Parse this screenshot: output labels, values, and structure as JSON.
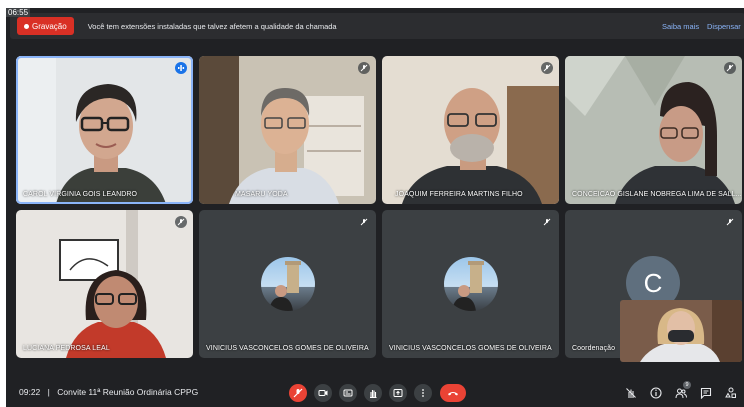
{
  "clock": "06:55",
  "banner": {
    "recording_label": "Gravação",
    "message": "Você tem extensões instaladas que talvez afetem a qualidade da chamada",
    "learn_more": "Saiba mais",
    "dismiss": "Dispensar"
  },
  "participants": [
    {
      "name": "CAROL VIRGINIA GOIS LEANDRO",
      "speaking": true
    },
    {
      "name": "MASARU YODA"
    },
    {
      "name": "JOAQUIM FERREIRA MARTINS FILHO"
    },
    {
      "name": "CONCEICAO GISLANE NOBREGA LIMA DE SALL..."
    },
    {
      "name": "LUCIANA PEDROSA LEAL"
    },
    {
      "name": "VINICIUS VASCONCELOS GOMES DE OLIVEIRA"
    },
    {
      "name": "VINICIUS VASCONCELOS GOMES DE OLIVEIRA"
    },
    {
      "name": "Coordenação",
      "avatar_letter": "C"
    }
  ],
  "meeting": {
    "time": "09:22",
    "separator": "|",
    "title": "Convite 11ª Reunião Ordinária CPPG"
  },
  "people_count": "9",
  "colors": {
    "recording": "#d93025",
    "link": "#8ab4f8",
    "active_speaker": "#1a73e8",
    "end_call": "#ea4335",
    "background": "#202124"
  },
  "icons": {
    "controls": [
      "mic-off-icon",
      "camera-icon",
      "captions-icon",
      "raise-hand-icon",
      "present-icon",
      "more-options-icon",
      "end-call-icon"
    ],
    "right": [
      "hand-off-icon",
      "info-icon",
      "people-icon",
      "chat-icon",
      "activities-icon"
    ]
  }
}
